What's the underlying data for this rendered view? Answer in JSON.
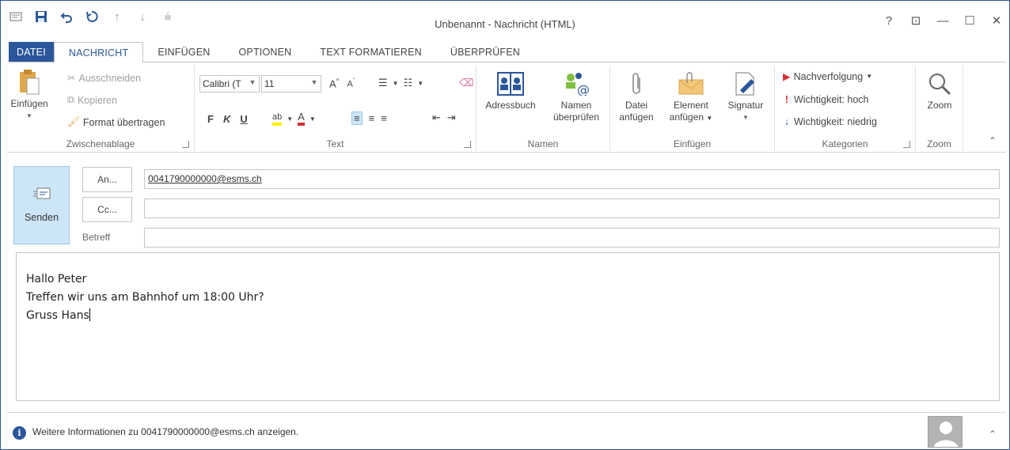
{
  "window": {
    "title": "Unbenannt - Nachricht (HTML)"
  },
  "quick_access": [
    "mail-icon",
    "save-icon",
    "undo-icon",
    "redo-icon",
    "up-arrow-icon",
    "down-arrow-icon",
    "customize-icon"
  ],
  "window_controls": {
    "help": "?",
    "ribbon_display": "⊡",
    "minimize": "—",
    "maximize": "☐",
    "close": "✕"
  },
  "tabs": [
    {
      "label": "DATEI"
    },
    {
      "label": "NACHRICHT"
    },
    {
      "label": "EINFÜGEN"
    },
    {
      "label": "OPTIONEN"
    },
    {
      "label": "TEXT FORMATIEREN"
    },
    {
      "label": "ÜBERPRÜFEN"
    }
  ],
  "ribbon": {
    "clipboard": {
      "label": "Zwischenablage",
      "paste": "Einfügen",
      "cut": "Ausschneiden",
      "copy": "Kopieren",
      "format_painter": "Format übertragen"
    },
    "text": {
      "label": "Text",
      "font": "Calibri (T",
      "size": "11",
      "bold": "F",
      "italic": "K",
      "underline": "U"
    },
    "names": {
      "label": "Namen",
      "address_book": "Adressbuch",
      "check_names_1": "Namen",
      "check_names_2": "überprüfen"
    },
    "insert": {
      "label": "Einfügen",
      "attach_file_1": "Datei",
      "attach_file_2": "anfügen",
      "attach_item_1": "Element",
      "attach_item_2": "anfügen",
      "signature": "Signatur"
    },
    "tags": {
      "label": "Kategorien",
      "follow_up": "Nachverfolgung",
      "high": "Wichtigkeit: hoch",
      "low": "Wichtigkeit: niedrig"
    },
    "zoom": {
      "label": "Zoom",
      "button": "Zoom"
    }
  },
  "compose": {
    "send": "Senden",
    "to_button": "An...",
    "cc_button": "Cc...",
    "subject_label": "Betreff",
    "to_value": "0041790000000@esms.ch",
    "cc_value": "",
    "subject_value": "",
    "body_lines": [
      "Hallo Peter",
      "Treffen wir uns am Bahnhof um 18:00 Uhr?",
      "Gruss Hans"
    ]
  },
  "footer": {
    "info": "Weitere Informationen zu 0041790000000@esms.ch anzeigen."
  },
  "colors": {
    "accent": "#2b579a",
    "send_bg": "#cde6f7",
    "follow_up_flag": "#d13438",
    "importance_high": "#d13438",
    "importance_low": "#2b579a"
  }
}
